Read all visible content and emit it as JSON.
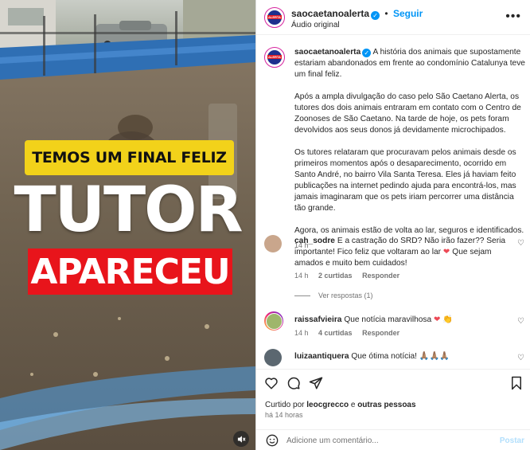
{
  "video": {
    "banner_top": "TEMOS UM FINAL FELIZ",
    "banner_big": "TUTOR",
    "banner_red": "APARECEU",
    "mute_icon": "speaker-muted-icon"
  },
  "header": {
    "username": "saocaetanoalerta",
    "follow_separator": "•",
    "follow_label": "Seguir",
    "audio_label": "Áudio original",
    "more_icon": "more-dots-icon"
  },
  "caption": {
    "username": "saocaetanoalerta",
    "paragraph_1": "A história dos animais que supostamente estariam abandonados em frente ao condomínio Catalunya teve um final feliz.",
    "paragraph_2": "Após a ampla divulgação do caso pelo São Caetano Alerta, os tutores dos dois animais entraram em contato com o Centro de Zoonoses de São Caetano. Na tarde de hoje, os pets foram devolvidos aos seus donos já devidamente microchipados.",
    "paragraph_3": "Os tutores relataram que procuravam pelos animais desde os primeiros momentos após o desaparecimento, ocorrido em Santo André, no bairro Vila Santa Teresa. Eles já haviam feito publicações na internet pedindo ajuda para encontrá-los, mas jamais imaginaram que os pets iriam percorrer uma distância tão grande.",
    "paragraph_4": "Agora, os animais estão de volta ao lar, seguros e identificados.",
    "time": "14 h"
  },
  "comments": [
    {
      "username": "cah_sodre",
      "text": "E a castração do SRD? Não irão fazer?? Seria importante! Fico feliz que voltaram ao lar",
      "text_after": "Que sejam amados e muito bem cuidados!",
      "time": "14 h",
      "likes": "2 curtidas",
      "reply_label": "Responder",
      "view_replies": "Ver respostas (1)"
    },
    {
      "username": "raissafvieira",
      "text": "Que notícia maravilhosa",
      "time": "14 h",
      "likes": "4 curtidas",
      "reply_label": "Responder"
    },
    {
      "username": "luizaantiquera",
      "text": "Que ótima notícia!",
      "emoji": "🙏🏽🙏🏽🙏🏽"
    }
  ],
  "actions": {
    "liked_prefix": "Curtido por",
    "liked_user": "leocgrecco",
    "liked_joiner": "e",
    "liked_others": "outras pessoas",
    "time_ago": "há 14 horas"
  },
  "composer": {
    "placeholder": "Adicione um comentário...",
    "post_label": "Postar"
  },
  "colors": {
    "accent_blue": "#0095f6",
    "banner_yellow": "#f2d21a",
    "banner_red": "#e8141b",
    "heart_red": "#ed4956"
  }
}
